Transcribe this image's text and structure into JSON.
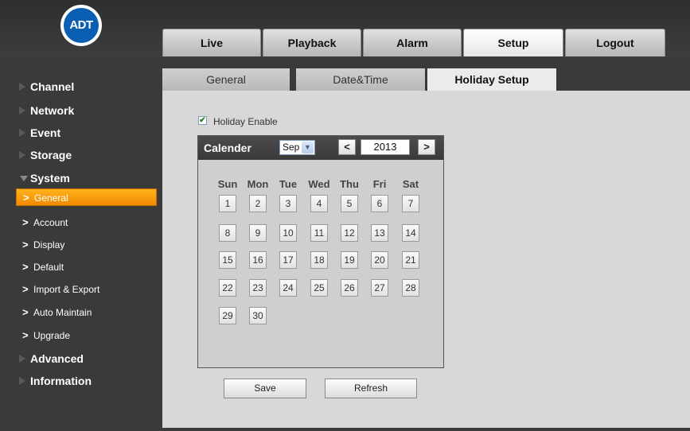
{
  "logo": {
    "text": "ADT",
    "color": "#0b5fb3"
  },
  "top_tabs": [
    {
      "label": "Live"
    },
    {
      "label": "Playback"
    },
    {
      "label": "Alarm"
    },
    {
      "label": "Setup",
      "active": true
    },
    {
      "label": "Logout"
    }
  ],
  "sidebar": {
    "channel": "Channel",
    "network": "Network",
    "event": "Event",
    "storage": "Storage",
    "system": "System",
    "system_items": [
      "General",
      "Account",
      "Display",
      "Default",
      "Import & Export",
      "Auto Maintain",
      "Upgrade"
    ],
    "advanced": "Advanced",
    "information": "Information",
    "active_color": "#f79a0e"
  },
  "sub_tabs": [
    {
      "label": "General"
    },
    {
      "label": "Date&Time"
    },
    {
      "label": "Holiday Setup",
      "active": true
    }
  ],
  "holiday": {
    "enable_label": "Holiday Enable",
    "enabled": true,
    "checkmark": "✔"
  },
  "calendar": {
    "title": "Calender",
    "month": "Sep",
    "year": "2013",
    "prev": "<",
    "next": ">",
    "dropdown_icon": "▼",
    "weekdays": [
      "Sun",
      "Mon",
      "Tue",
      "Wed",
      "Thu",
      "Fri",
      "Sat"
    ],
    "days": [
      "1",
      "2",
      "3",
      "4",
      "5",
      "6",
      "7",
      "8",
      "9",
      "10",
      "11",
      "12",
      "13",
      "14",
      "15",
      "16",
      "17",
      "18",
      "19",
      "20",
      "21",
      "22",
      "23",
      "24",
      "25",
      "26",
      "27",
      "28",
      "29",
      "30"
    ]
  },
  "buttons": {
    "save": "Save",
    "refresh": "Refresh"
  }
}
